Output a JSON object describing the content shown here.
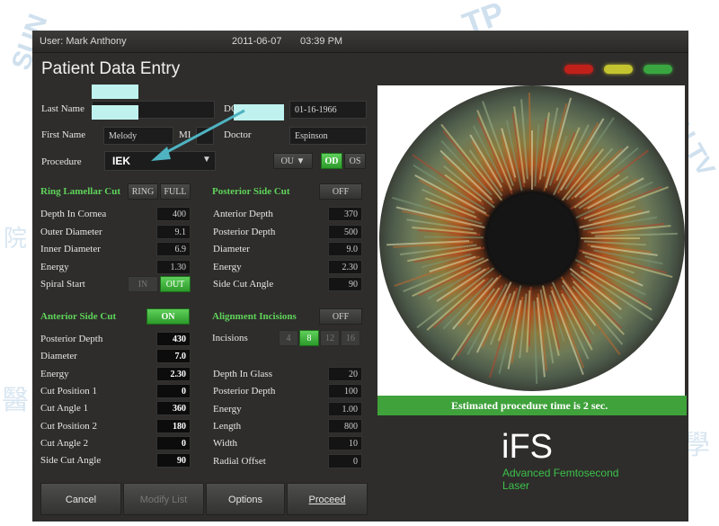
{
  "topbar": {
    "user": "User: Mark Anthony",
    "date": "2011-06-07",
    "time": "03:39 PM"
  },
  "title": "Patient Data Entry",
  "status_lights": {
    "red": "#c0201a",
    "yellow": "#c4c430",
    "green": "#3aa640"
  },
  "patient": {
    "last_name_label": "Last Name",
    "dob_label": "DO",
    "dob_value": "01-16-1966",
    "first_name_label": "First Name",
    "first_name_value": "Melody",
    "mi_label": "MI",
    "doctor_label": "Doctor",
    "doctor_value": "Espinson",
    "procedure_label": "Procedure",
    "procedure_value": "IEK",
    "ou_label": "OU",
    "od_label": "OD",
    "os_label": "OS"
  },
  "ring": {
    "title": "Ring Lamellar Cut",
    "ring_btn": "RING",
    "full_btn": "FULL",
    "rows": [
      {
        "label": "Depth In Cornea",
        "value": "400"
      },
      {
        "label": "Outer Diameter",
        "value": "9.1"
      },
      {
        "label": "Inner Diameter",
        "value": "6.9"
      },
      {
        "label": "Energy",
        "value": "1.30"
      }
    ],
    "spiral_label": "Spiral Start",
    "spiral_in": "IN",
    "spiral_out": "OUT"
  },
  "posterior": {
    "title": "Posterior Side Cut",
    "toggle": "OFF",
    "rows": [
      {
        "label": "Anterior Depth",
        "value": "370"
      },
      {
        "label": "Posterior Depth",
        "value": "500"
      },
      {
        "label": "Diameter",
        "value": "9.0"
      },
      {
        "label": "Energy",
        "value": "2.30"
      },
      {
        "label": "Side Cut Angle",
        "value": "90"
      }
    ]
  },
  "anterior": {
    "title": "Anterior Side Cut",
    "toggle": "ON",
    "rows": [
      {
        "label": "Posterior Depth",
        "value": "430"
      },
      {
        "label": "Diameter",
        "value": "7.0"
      },
      {
        "label": "Energy",
        "value": "2.30"
      },
      {
        "label": "Cut Position 1",
        "value": "0"
      },
      {
        "label": "Cut Angle 1",
        "value": "360"
      },
      {
        "label": "Cut Position 2",
        "value": "180"
      },
      {
        "label": "Cut Angle 2",
        "value": "0"
      },
      {
        "label": "Side Cut Angle",
        "value": "90"
      }
    ]
  },
  "alignment": {
    "title": "Alignment Incisions",
    "toggle": "OFF",
    "incisions_label": "Incisions",
    "incision_options": [
      "4",
      "8",
      "12",
      "16"
    ],
    "incision_selected": "8",
    "rows": [
      {
        "label": "Depth In Glass",
        "value": "20"
      },
      {
        "label": "Posterior Depth",
        "value": "100"
      },
      {
        "label": "Energy",
        "value": "1.00"
      },
      {
        "label": "Length",
        "value": "800"
      },
      {
        "label": "Width",
        "value": "10"
      },
      {
        "label": "Radial Offset",
        "value": "0"
      }
    ]
  },
  "estimate": "Estimated procedure time is 2 sec.",
  "brand": {
    "logo": "iFS",
    "line1": "Advanced Femtosecond",
    "line2": "Laser",
    "color": "#3cc04a"
  },
  "footer": {
    "cancel": "Cancel",
    "modify": "Modify List",
    "options": "Options",
    "proceed": "Proceed"
  },
  "watermark": [
    "TP",
    "SUN",
    "U.TV",
    "醫",
    "學",
    "院"
  ]
}
